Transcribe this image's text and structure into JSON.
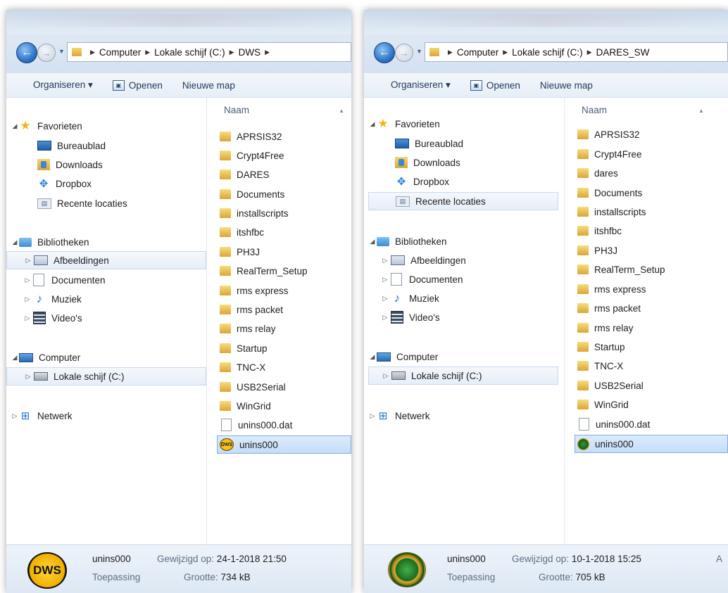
{
  "left": {
    "breadcrumbs": [
      "Computer",
      "Lokale schijf (C:)",
      "DWS"
    ],
    "toolbar": {
      "organize": "Organiseren ▾",
      "open": "Openen",
      "newfolder": "Nieuwe map"
    },
    "nav": {
      "favorites": "Favorieten",
      "desktop": "Bureaublad",
      "downloads": "Downloads",
      "dropbox": "Dropbox",
      "recent": "Recente locaties",
      "libraries": "Bibliotheken",
      "pictures": "Afbeeldingen",
      "documents": "Documenten",
      "music": "Muziek",
      "videos": "Video's",
      "computer": "Computer",
      "localdisk": "Lokale schijf (C:)",
      "network": "Netwerk"
    },
    "column": "Naam",
    "files": [
      "APRSIS32",
      "Crypt4Free",
      "DARES",
      "Documents",
      "installscripts",
      "itshfbc",
      "PH3J",
      "RealTerm_Setup",
      "rms express",
      "rms packet",
      "rms relay",
      "Startup",
      "TNC-X",
      "USB2Serial",
      "WinGrid",
      "unins000.dat",
      "unins000"
    ],
    "details": {
      "name": "unins000",
      "type": "Toepassing",
      "modified_label": "Gewijzigd op:",
      "modified": "24-1-2018 21:50",
      "size_label": "Grootte:",
      "size": "734 kB",
      "icon_text": "DWS"
    }
  },
  "right": {
    "breadcrumbs": [
      "Computer",
      "Lokale schijf (C:)",
      "DARES_SW"
    ],
    "toolbar": {
      "organize": "Organiseren ▾",
      "open": "Openen",
      "newfolder": "Nieuwe map"
    },
    "nav": {
      "favorites": "Favorieten",
      "desktop": "Bureaublad",
      "downloads": "Downloads",
      "dropbox": "Dropbox",
      "recent": "Recente locaties",
      "libraries": "Bibliotheken",
      "pictures": "Afbeeldingen",
      "documents": "Documenten",
      "music": "Muziek",
      "videos": "Video's",
      "computer": "Computer",
      "localdisk": "Lokale schijf (C:)",
      "network": "Netwerk"
    },
    "column": "Naam",
    "files": [
      "APRSIS32",
      "Crypt4Free",
      "dares",
      "Documents",
      "installscripts",
      "itshfbc",
      "PH3J",
      "RealTerm_Setup",
      "rms express",
      "rms packet",
      "rms relay",
      "Startup",
      "TNC-X",
      "USB2Serial",
      "WinGrid",
      "unins000.dat",
      "unins000"
    ],
    "details": {
      "name": "unins000",
      "type": "Toepassing",
      "modified_label": "Gewijzigd op:",
      "modified": "10-1-2018 15:25",
      "size_label": "Grootte:",
      "size": "705 kB",
      "extra": "A"
    }
  }
}
